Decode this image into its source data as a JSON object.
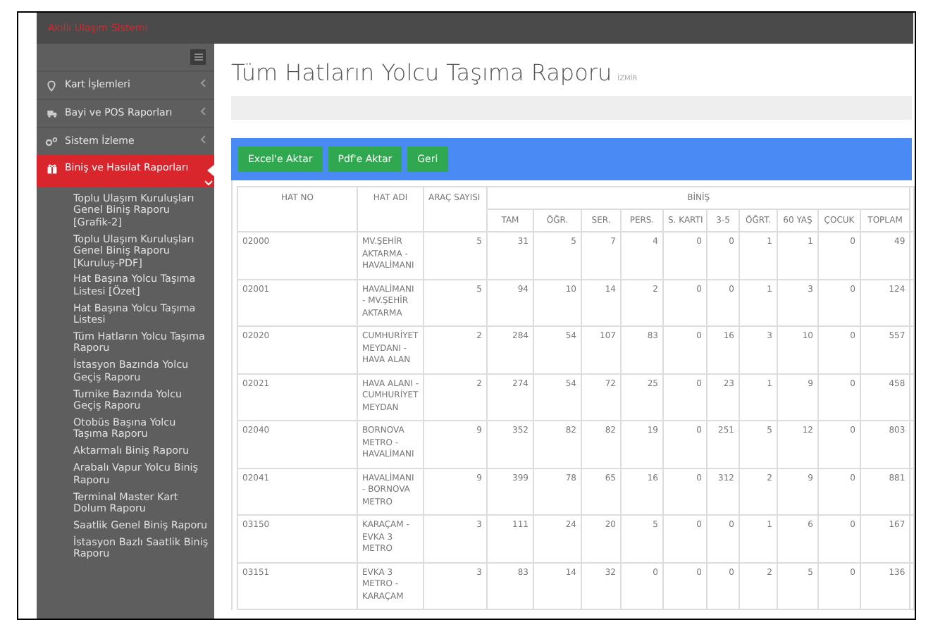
{
  "brand": "Akıllı Ulaşım Sistemi",
  "sidebar": {
    "items": [
      {
        "label": "Kart İşlemleri",
        "selected": false
      },
      {
        "label": "Bayi ve POS Raporları",
        "selected": false
      },
      {
        "label": "Sistem İzleme",
        "selected": false
      },
      {
        "label": "Biniş ve Hasılat Raporları",
        "selected": true,
        "expanded": true,
        "children": [
          {
            "label": "Toplu Ulaşım Kuruluşları Genel Biniş Raporu [Grafik-2]"
          },
          {
            "label": "Toplu Ulaşım Kuruluşları Genel Biniş Raporu [Kuruluş-PDF]"
          },
          {
            "label": "Hat Başına Yolcu Taşıma Listesi [Özet]"
          },
          {
            "label": "Hat Başına Yolcu Taşıma Listesi"
          },
          {
            "label": "Tüm Hatların Yolcu Taşıma Raporu"
          },
          {
            "label": "İstasyon Bazında Yolcu Geçiş Raporu"
          },
          {
            "label": "Turnike Bazında Yolcu Geçiş Raporu"
          },
          {
            "label": "Otobüs Başına Yolcu Taşıma Raporu"
          },
          {
            "label": "Aktarmalı Biniş Raporu"
          },
          {
            "label": "Arabalı Vapur Yolcu Biniş Raporu"
          },
          {
            "label": "Terminal Master Kart Dolum Raporu"
          },
          {
            "label": "Saatlik Genel Biniş Raporu"
          },
          {
            "label": "İstasyon Bazlı Saatlik Biniş Raporu"
          }
        ]
      }
    ]
  },
  "page": {
    "title": "Tüm Hatların Yolcu Taşıma Raporu",
    "subtitle": "İZMİR"
  },
  "buttons": [
    "Excel'e Aktar",
    "Pdf'e Aktar",
    "Geri"
  ],
  "table": {
    "columns": [
      "HAT NO",
      "HAT ADI",
      "ARAÇ SAYISI"
    ],
    "group": "BİNİŞ",
    "subcolumns": [
      "TAM",
      "ÖĞR.",
      "SER.",
      "PERS.",
      "S. KARTI",
      "3-5",
      "ÖĞRT.",
      "60 YAŞ",
      "ÇOCUK",
      "TOPLAM"
    ],
    "rows": [
      [
        "02000",
        "MV.ŞEHİR AKTARMA - HAVALİMANI",
        "5",
        "31",
        "5",
        "7",
        "4",
        "0",
        "0",
        "1",
        "1",
        "0",
        "49"
      ],
      [
        "02001",
        "HAVALİMANI - MV.ŞEHİR AKTARMA",
        "5",
        "94",
        "10",
        "14",
        "2",
        "0",
        "0",
        "1",
        "3",
        "0",
        "124"
      ],
      [
        "02020",
        "CUMHURİYET MEYDANI - HAVA ALAN",
        "2",
        "284",
        "54",
        "107",
        "83",
        "0",
        "16",
        "3",
        "10",
        "0",
        "557"
      ],
      [
        "02021",
        "HAVA ALANI - CUMHURİYET MEYDAN",
        "2",
        "274",
        "54",
        "72",
        "25",
        "0",
        "23",
        "1",
        "9",
        "0",
        "458"
      ],
      [
        "02040",
        "BORNOVA METRO - HAVALİMANI",
        "9",
        "352",
        "82",
        "82",
        "19",
        "0",
        "251",
        "5",
        "12",
        "0",
        "803"
      ],
      [
        "02041",
        "HAVALİMANI - BORNOVA METRO",
        "9",
        "399",
        "78",
        "65",
        "16",
        "0",
        "312",
        "2",
        "9",
        "0",
        "881"
      ],
      [
        "03150",
        "KARAÇAM - EVKA 3 METRO",
        "3",
        "111",
        "24",
        "20",
        "5",
        "0",
        "0",
        "1",
        "6",
        "0",
        "167"
      ],
      [
        "03151",
        "EVKA 3 METRO - KARAÇAM",
        "3",
        "83",
        "14",
        "32",
        "0",
        "0",
        "0",
        "2",
        "5",
        "0",
        "136"
      ]
    ]
  }
}
